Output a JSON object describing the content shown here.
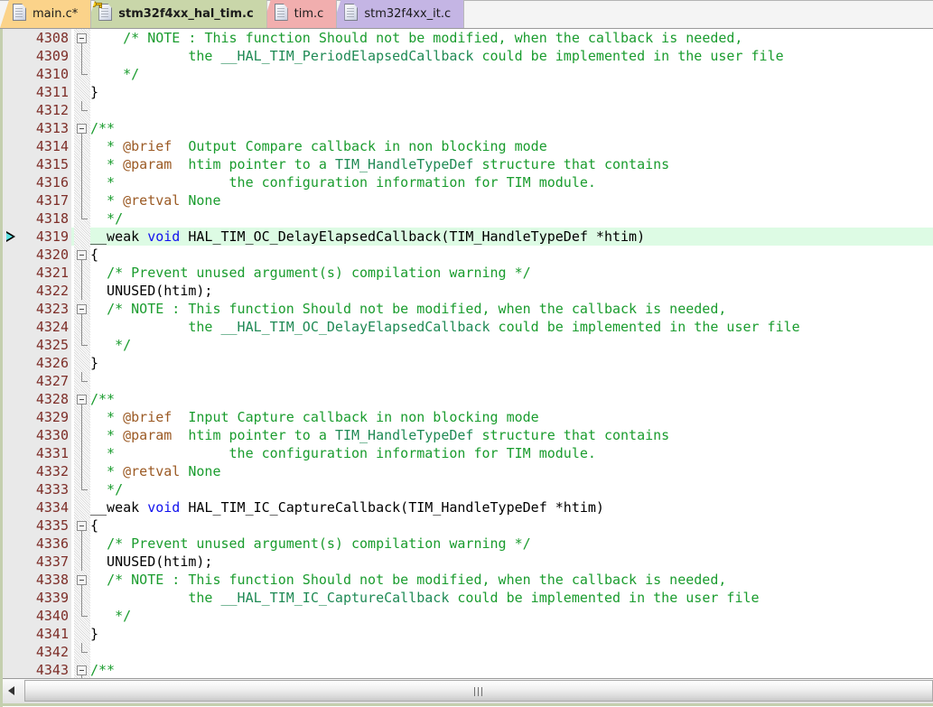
{
  "window": {
    "title": "stm32f4xx_hal_tim.c",
    "accent_color": "#c4cfae",
    "highlight_color": "#ddfbe4",
    "linenumber_color": "#7d2e28",
    "comment_color": "#1a9c2e",
    "keyword_color": "#1111ee",
    "doxytag_color": "#9b5a24"
  },
  "tabbar": {
    "tabs": [
      {
        "label": "main.c*",
        "color": "#fbd38a",
        "active": false,
        "modified": true,
        "locked": false,
        "icon": "file-icon"
      },
      {
        "label": "stm32f4xx_hal_tim.c",
        "color": "#c9d6a9",
        "active": true,
        "modified": false,
        "locked": true,
        "icon": "file-icon"
      },
      {
        "label": "tim.c",
        "color": "#f1aeae",
        "active": false,
        "modified": false,
        "locked": false,
        "icon": "file-icon"
      },
      {
        "label": "stm32f4xx_it.c",
        "color": "#c4b5e4",
        "active": false,
        "modified": false,
        "locked": false,
        "icon": "file-icon"
      }
    ]
  },
  "editor": {
    "first_line": 4308,
    "current_statement_line": 4319,
    "highlighted_line": 4319,
    "lines": [
      {
        "n": "4308",
        "fold": "box",
        "marker": "",
        "tokens": [
          {
            "t": "    ",
            "c": "pl"
          },
          {
            "t": "/* NOTE : ",
            "c": "cm"
          },
          {
            "t": "This function Should not be modified, when the callback is needed,",
            "c": "cm"
          }
        ]
      },
      {
        "n": "4309",
        "fold": "line",
        "marker": "",
        "tokens": [
          {
            "t": "            the ",
            "c": "cm"
          },
          {
            "t": "__HAL_TIM_PeriodElapsedCallback",
            "c": "cmd"
          },
          {
            "t": " could be implemented in the user file",
            "c": "cm"
          }
        ]
      },
      {
        "n": "4310",
        "fold": "tick",
        "marker": "",
        "tokens": [
          {
            "t": "    ",
            "c": "pl"
          },
          {
            "t": "*/",
            "c": "cm"
          }
        ]
      },
      {
        "n": "4311",
        "fold": "none",
        "marker": "",
        "tokens": [
          {
            "t": "}",
            "c": "pl"
          }
        ]
      },
      {
        "n": "4312",
        "fold": "tick",
        "marker": "",
        "tokens": [
          {
            "t": "",
            "c": "pl"
          }
        ]
      },
      {
        "n": "4313",
        "fold": "box",
        "marker": "",
        "tokens": [
          {
            "t": "/**",
            "c": "cm"
          }
        ]
      },
      {
        "n": "4314",
        "fold": "line",
        "marker": "",
        "tokens": [
          {
            "t": "  * ",
            "c": "cm"
          },
          {
            "t": "@brief",
            "c": "tag"
          },
          {
            "t": "  Output Compare callback in non blocking mode",
            "c": "cm"
          }
        ]
      },
      {
        "n": "4315",
        "fold": "line",
        "marker": "",
        "tokens": [
          {
            "t": "  * ",
            "c": "cm"
          },
          {
            "t": "@param",
            "c": "tag"
          },
          {
            "t": "  htim pointer to a ",
            "c": "cm"
          },
          {
            "t": "TIM_HandleTypeDef",
            "c": "cmd"
          },
          {
            "t": " structure that contains",
            "c": "cm"
          }
        ]
      },
      {
        "n": "4316",
        "fold": "line",
        "marker": "",
        "tokens": [
          {
            "t": "  *              the configuration information for TIM module.",
            "c": "cm"
          }
        ]
      },
      {
        "n": "4317",
        "fold": "line",
        "marker": "",
        "tokens": [
          {
            "t": "  * ",
            "c": "cm"
          },
          {
            "t": "@retval",
            "c": "tag"
          },
          {
            "t": " None",
            "c": "cm"
          }
        ]
      },
      {
        "n": "4318",
        "fold": "tick",
        "marker": "",
        "tokens": [
          {
            "t": "  */",
            "c": "cm"
          }
        ]
      },
      {
        "n": "4319",
        "fold": "none",
        "marker": "arrow",
        "hl": true,
        "tokens": [
          {
            "t": "__weak ",
            "c": "pl"
          },
          {
            "t": "void",
            "c": "kw"
          },
          {
            "t": " HAL_TIM_OC_DelayElapsedCallback(TIM_HandleTypeDef *htim)",
            "c": "pl"
          }
        ]
      },
      {
        "n": "4320",
        "fold": "box",
        "marker": "",
        "tokens": [
          {
            "t": "{",
            "c": "pl"
          }
        ]
      },
      {
        "n": "4321",
        "fold": "line",
        "marker": "",
        "tokens": [
          {
            "t": "  ",
            "c": "pl"
          },
          {
            "t": "/* Prevent unused argument(s) compilation warning */",
            "c": "cm"
          }
        ]
      },
      {
        "n": "4322",
        "fold": "line",
        "marker": "",
        "tokens": [
          {
            "t": "  UNUSED(htim);",
            "c": "pl"
          }
        ]
      },
      {
        "n": "4323",
        "fold": "box",
        "marker": "",
        "tokens": [
          {
            "t": "  ",
            "c": "pl"
          },
          {
            "t": "/* NOTE : This function Should not be modified, when the callback is needed,",
            "c": "cm"
          }
        ]
      },
      {
        "n": "4324",
        "fold": "line",
        "marker": "",
        "tokens": [
          {
            "t": "            the ",
            "c": "cm"
          },
          {
            "t": "__HAL_TIM_OC_DelayElapsedCallback",
            "c": "cmd"
          },
          {
            "t": " could be implemented in the user file",
            "c": "cm"
          }
        ]
      },
      {
        "n": "4325",
        "fold": "tick",
        "marker": "",
        "tokens": [
          {
            "t": "   ",
            "c": "pl"
          },
          {
            "t": "*/",
            "c": "cm"
          }
        ]
      },
      {
        "n": "4326",
        "fold": "none",
        "marker": "",
        "tokens": [
          {
            "t": "}",
            "c": "pl"
          }
        ]
      },
      {
        "n": "4327",
        "fold": "tick",
        "marker": "",
        "tokens": [
          {
            "t": "",
            "c": "pl"
          }
        ]
      },
      {
        "n": "4328",
        "fold": "box",
        "marker": "",
        "tokens": [
          {
            "t": "/**",
            "c": "cm"
          }
        ]
      },
      {
        "n": "4329",
        "fold": "line",
        "marker": "",
        "tokens": [
          {
            "t": "  * ",
            "c": "cm"
          },
          {
            "t": "@brief",
            "c": "tag"
          },
          {
            "t": "  Input Capture callback in non blocking mode",
            "c": "cm"
          }
        ]
      },
      {
        "n": "4330",
        "fold": "line",
        "marker": "",
        "tokens": [
          {
            "t": "  * ",
            "c": "cm"
          },
          {
            "t": "@param",
            "c": "tag"
          },
          {
            "t": "  htim pointer to a ",
            "c": "cm"
          },
          {
            "t": "TIM_HandleTypeDef",
            "c": "cmd"
          },
          {
            "t": " structure that contains",
            "c": "cm"
          }
        ]
      },
      {
        "n": "4331",
        "fold": "line",
        "marker": "",
        "tokens": [
          {
            "t": "  *              the configuration information for TIM module.",
            "c": "cm"
          }
        ]
      },
      {
        "n": "4332",
        "fold": "line",
        "marker": "",
        "tokens": [
          {
            "t": "  * ",
            "c": "cm"
          },
          {
            "t": "@retval",
            "c": "tag"
          },
          {
            "t": " None",
            "c": "cm"
          }
        ]
      },
      {
        "n": "4333",
        "fold": "tick",
        "marker": "",
        "tokens": [
          {
            "t": "  */",
            "c": "cm"
          }
        ]
      },
      {
        "n": "4334",
        "fold": "none",
        "marker": "",
        "tokens": [
          {
            "t": "__weak ",
            "c": "pl"
          },
          {
            "t": "void",
            "c": "kw"
          },
          {
            "t": " HAL_TIM_IC_CaptureCallback(TIM_HandleTypeDef *htim)",
            "c": "pl"
          }
        ]
      },
      {
        "n": "4335",
        "fold": "box",
        "marker": "",
        "tokens": [
          {
            "t": "{",
            "c": "pl"
          }
        ]
      },
      {
        "n": "4336",
        "fold": "line",
        "marker": "",
        "tokens": [
          {
            "t": "  ",
            "c": "pl"
          },
          {
            "t": "/* Prevent unused argument(s) compilation warning */",
            "c": "cm"
          }
        ]
      },
      {
        "n": "4337",
        "fold": "line",
        "marker": "",
        "tokens": [
          {
            "t": "  UNUSED(htim);",
            "c": "pl"
          }
        ]
      },
      {
        "n": "4338",
        "fold": "box",
        "marker": "",
        "tokens": [
          {
            "t": "  ",
            "c": "pl"
          },
          {
            "t": "/* NOTE : This function Should not be modified, when the callback is needed,",
            "c": "cm"
          }
        ]
      },
      {
        "n": "4339",
        "fold": "line",
        "marker": "",
        "tokens": [
          {
            "t": "            the ",
            "c": "cm"
          },
          {
            "t": "__HAL_TIM_IC_CaptureCallback",
            "c": "cmd"
          },
          {
            "t": " could be implemented in the user file",
            "c": "cm"
          }
        ]
      },
      {
        "n": "4340",
        "fold": "tick",
        "marker": "",
        "tokens": [
          {
            "t": "   ",
            "c": "pl"
          },
          {
            "t": "*/",
            "c": "cm"
          }
        ]
      },
      {
        "n": "4341",
        "fold": "none",
        "marker": "",
        "tokens": [
          {
            "t": "}",
            "c": "pl"
          }
        ]
      },
      {
        "n": "4342",
        "fold": "tick",
        "marker": "",
        "tokens": [
          {
            "t": "",
            "c": "pl"
          }
        ]
      },
      {
        "n": "4343",
        "fold": "box",
        "marker": "",
        "tokens": [
          {
            "t": "/**",
            "c": "cm"
          }
        ]
      }
    ]
  },
  "scrollbar": {
    "left_arrow": "scroll-left-arrow-icon",
    "grip": "scrollbar-grip-icon",
    "orientation": "horizontal"
  }
}
